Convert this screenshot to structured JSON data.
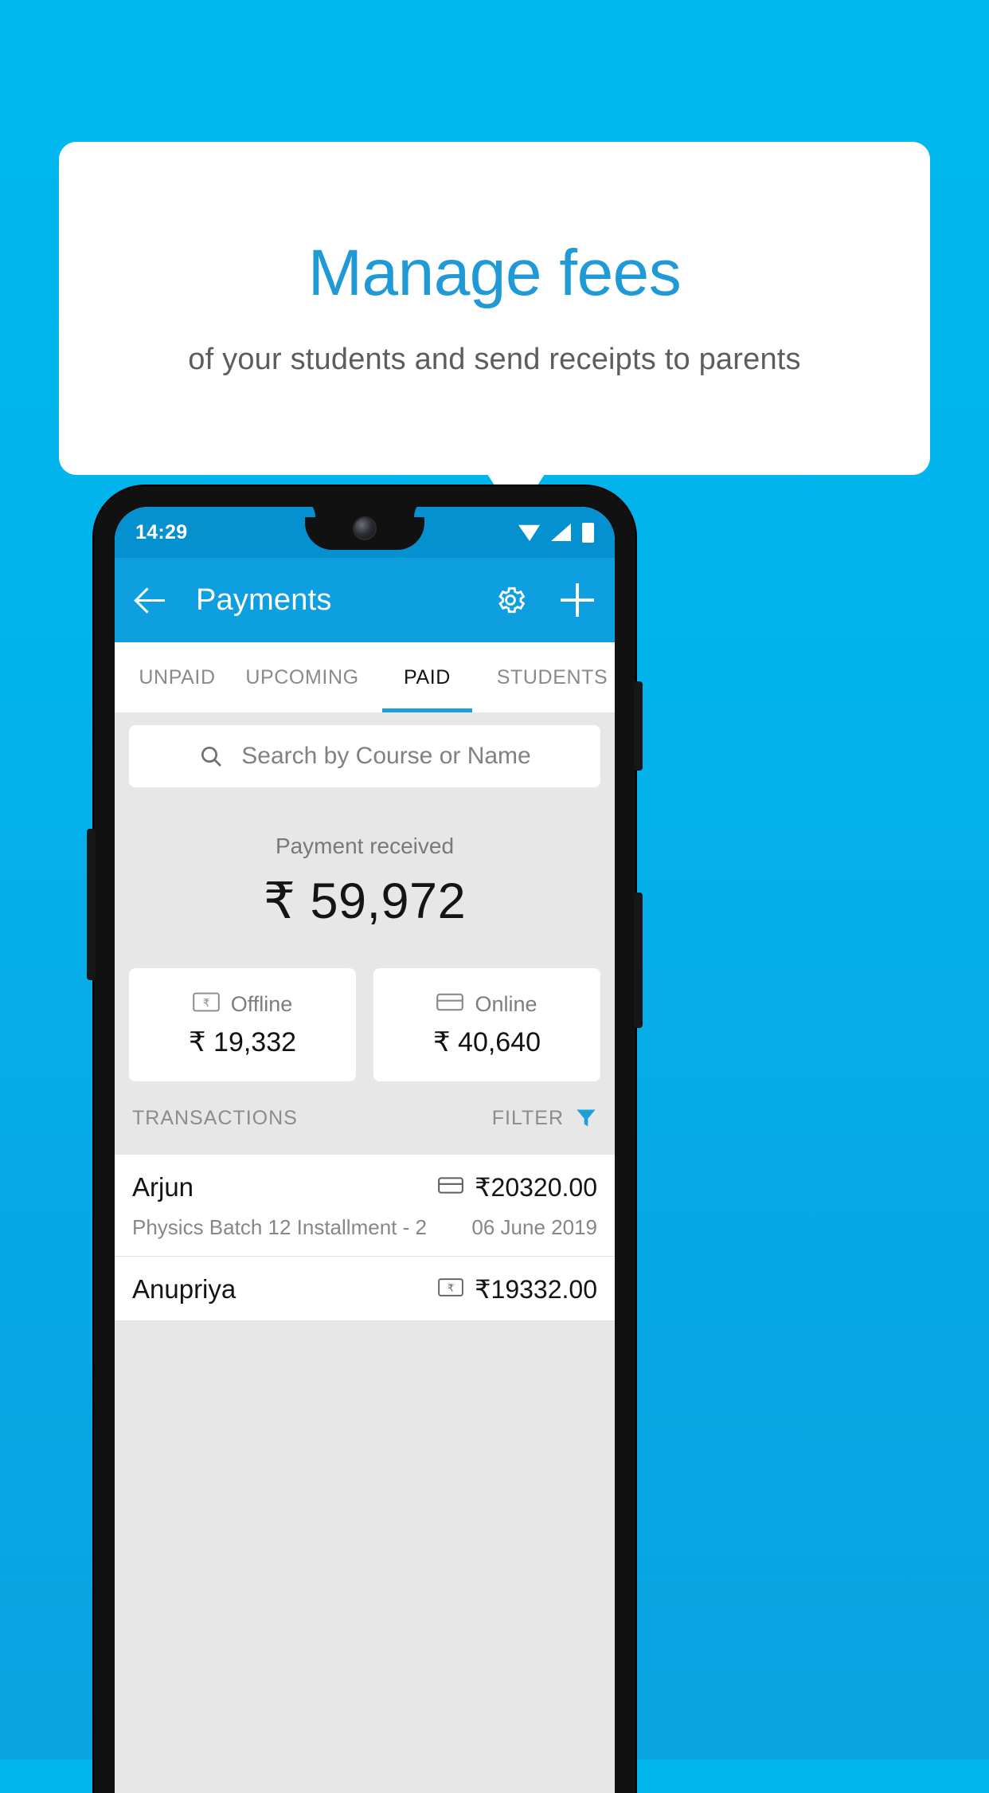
{
  "promo": {
    "title": "Manage fees",
    "subtitle": "of your students and send receipts to parents"
  },
  "phone": {
    "status_bar": {
      "time": "14:29",
      "icons": [
        "wifi-icon",
        "signal-icon",
        "battery-icon"
      ]
    },
    "app_bar": {
      "back_icon": "back-arrow-icon",
      "title": "Payments",
      "settings_icon": "gear-icon",
      "add_icon": "plus-icon"
    },
    "tabs": [
      {
        "label": "UNPAID",
        "active": false
      },
      {
        "label": "UPCOMING",
        "active": false
      },
      {
        "label": "PAID",
        "active": true
      },
      {
        "label": "STUDENTS",
        "active": false
      }
    ],
    "search": {
      "icon": "search-icon",
      "placeholder": "Search by Course or Name",
      "value": ""
    },
    "summary": {
      "label": "Payment received",
      "amount": "₹ 59,972"
    },
    "breakdown": [
      {
        "icon": "cash-note-icon",
        "label": "Offline",
        "amount": "₹ 19,332"
      },
      {
        "icon": "credit-card-icon",
        "label": "Online",
        "amount": "₹ 40,640"
      }
    ],
    "transactions_header": {
      "title": "TRANSACTIONS",
      "filter_label": "FILTER",
      "filter_icon": "funnel-icon"
    },
    "transactions": [
      {
        "name": "Arjun",
        "description": "Physics Batch 12 Installment - 2",
        "amount": "₹20320.00",
        "date": "06 June 2019",
        "method_icon": "credit-card-icon"
      },
      {
        "name": "Anupriya",
        "description": "",
        "amount": "₹19332.00",
        "date": "",
        "method_icon": "cash-note-icon"
      }
    ]
  },
  "colors": {
    "brand": "#00b5ec",
    "status_bar": "#0591cf",
    "app_bar": "#0e9fe0",
    "accent": "#1e9fd8",
    "title_blue": "#1f9ad6",
    "surface": "#ffffff",
    "page_bg": "#e7e7e7"
  }
}
